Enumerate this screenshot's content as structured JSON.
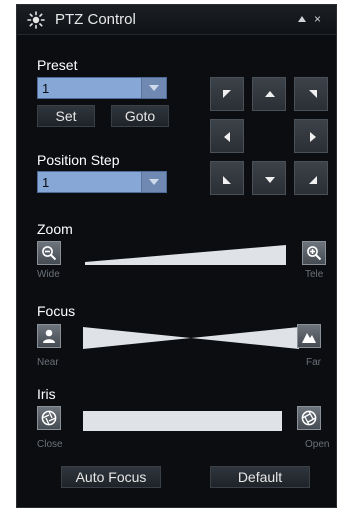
{
  "window": {
    "title": "PTZ Control",
    "close_glyph": "×"
  },
  "preset": {
    "label": "Preset",
    "value": "1",
    "set_label": "Set",
    "goto_label": "Goto"
  },
  "position_step": {
    "label": "Position Step",
    "value": "1"
  },
  "direction_pad": {
    "buttons": [
      "up-left",
      "up",
      "up-right",
      "left",
      "right",
      "down-left",
      "down",
      "down-right"
    ]
  },
  "zoom": {
    "label": "Zoom",
    "left_label": "Wide",
    "right_label": "Tele",
    "left_icon": "zoom-out-icon",
    "right_icon": "zoom-in-icon"
  },
  "focus": {
    "label": "Focus",
    "left_label": "Near",
    "right_label": "Far",
    "left_icon": "person-icon",
    "right_icon": "mountain-icon"
  },
  "iris": {
    "label": "Iris",
    "left_label": "Close",
    "right_label": "Open",
    "left_icon": "aperture-closed-icon",
    "right_icon": "aperture-open-icon"
  },
  "actions": {
    "auto_focus_label": "Auto Focus",
    "default_label": "Default"
  },
  "colors": {
    "panel_bg": "#0b0d10",
    "select_bg": "#87a7d6",
    "button_bg": "#2a2f35"
  }
}
